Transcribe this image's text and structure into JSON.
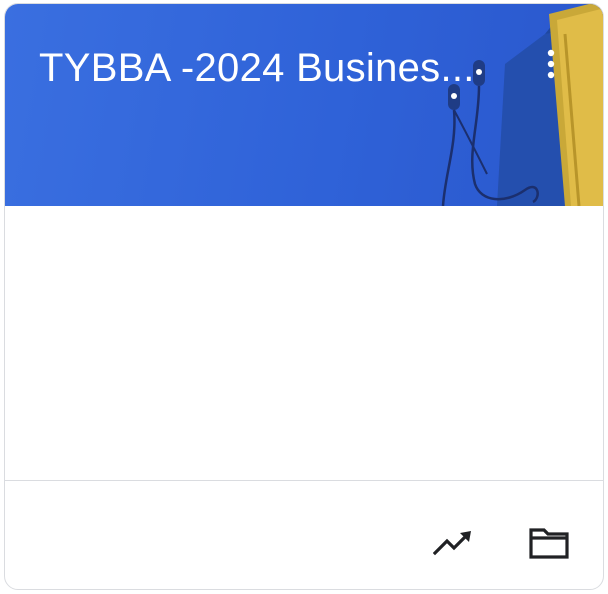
{
  "class_card": {
    "title": "TYBBA -2024 Busines...",
    "header_color": "#3367d6",
    "text_color": "#ffffff",
    "icons": {
      "more": "more-vert-icon",
      "trend": "trending-up-icon",
      "folder": "folder-icon"
    }
  }
}
